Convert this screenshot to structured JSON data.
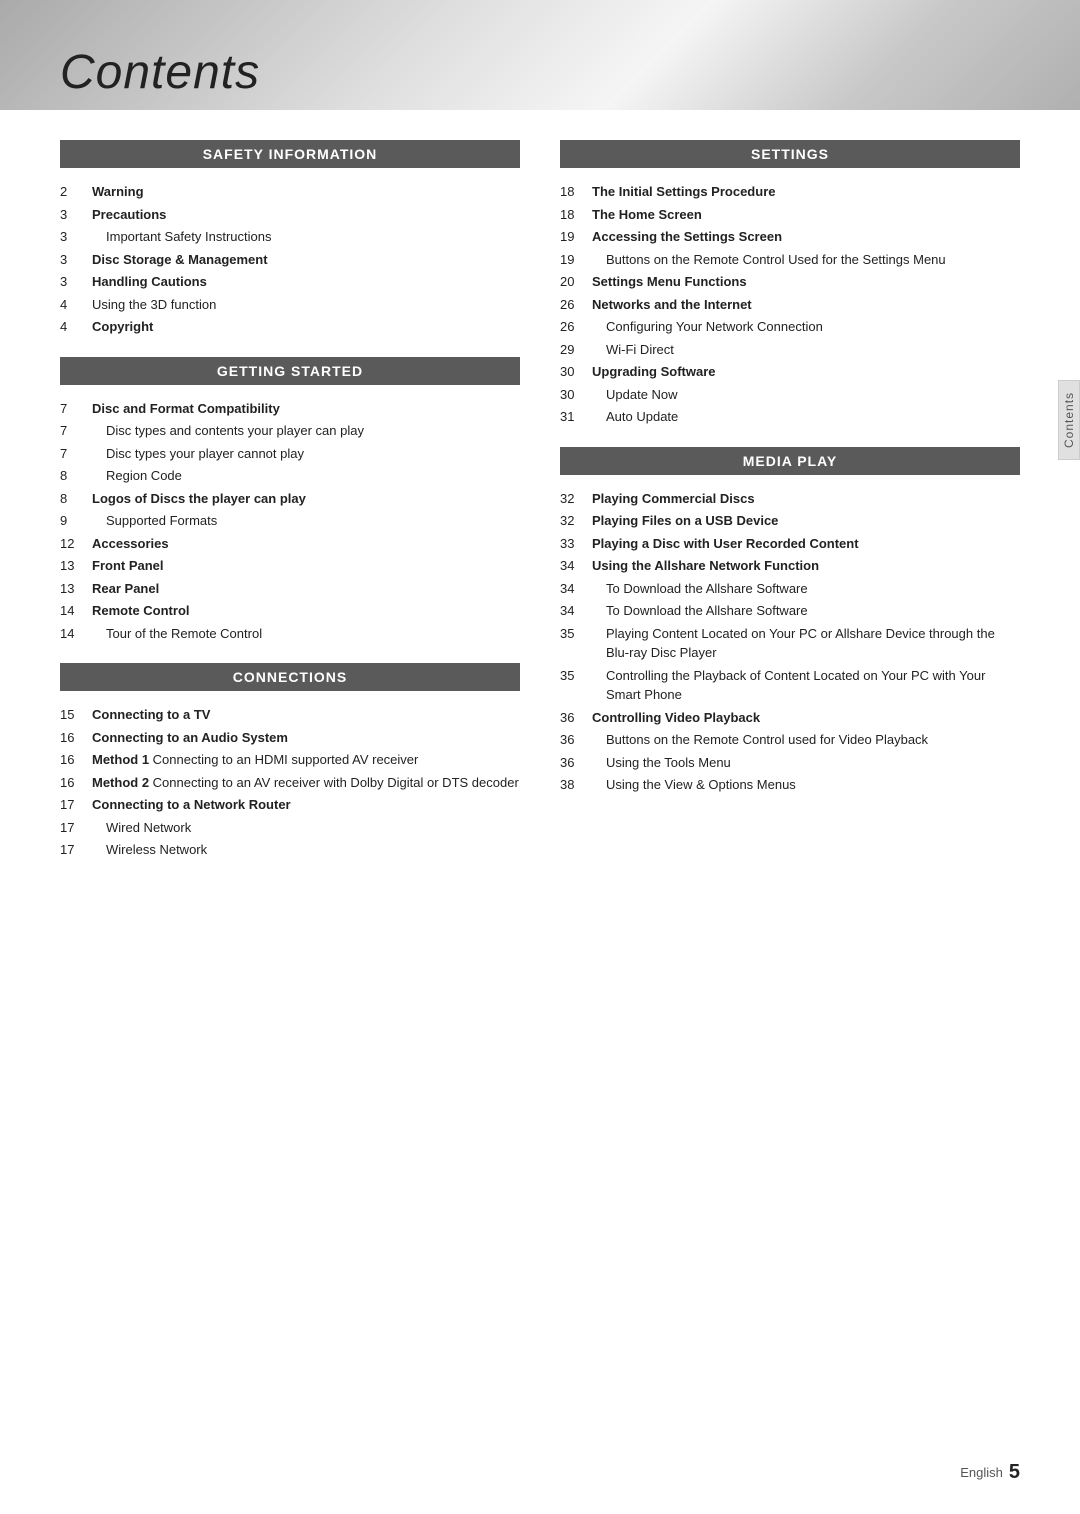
{
  "header": {
    "title": "Contents",
    "side_tab": "Contents"
  },
  "footer": {
    "label": "English",
    "page": "5"
  },
  "left_column": {
    "sections": [
      {
        "id": "safety",
        "header": "SAFETY INFORMATION",
        "entries": [
          {
            "num": "2",
            "text": "Warning",
            "style": "bold"
          },
          {
            "num": "3",
            "text": "Precautions",
            "style": "bold"
          },
          {
            "num": "3",
            "text": "Important Safety Instructions",
            "style": "indent"
          },
          {
            "num": "3",
            "text": "Disc Storage & Management",
            "style": "bold"
          },
          {
            "num": "3",
            "text": "Handling Cautions",
            "style": "bold"
          },
          {
            "num": "4",
            "text": "Using the 3D function",
            "style": "normal"
          },
          {
            "num": "4",
            "text": "Copyright",
            "style": "bold"
          }
        ]
      },
      {
        "id": "getting_started",
        "header": "GETTING STARTED",
        "entries": [
          {
            "num": "7",
            "text": "Disc and Format Compatibility",
            "style": "bold"
          },
          {
            "num": "7",
            "text": "Disc types and contents your player can play",
            "style": "indent"
          },
          {
            "num": "7",
            "text": "Disc types your player cannot play",
            "style": "indent"
          },
          {
            "num": "8",
            "text": "Region Code",
            "style": "indent"
          },
          {
            "num": "8",
            "text": "Logos of Discs the player can play",
            "style": "bold"
          },
          {
            "num": "9",
            "text": "Supported Formats",
            "style": "indent"
          },
          {
            "num": "12",
            "text": "Accessories",
            "style": "bold"
          },
          {
            "num": "13",
            "text": "Front Panel",
            "style": "bold"
          },
          {
            "num": "13",
            "text": "Rear Panel",
            "style": "bold"
          },
          {
            "num": "14",
            "text": "Remote Control",
            "style": "bold"
          },
          {
            "num": "14",
            "text": "Tour of the Remote Control",
            "style": "indent"
          }
        ]
      },
      {
        "id": "connections",
        "header": "CONNECTIONS",
        "entries": [
          {
            "num": "15",
            "text": "Connecting to a TV",
            "style": "bold"
          },
          {
            "num": "16",
            "text": "Connecting to an Audio System",
            "style": "bold"
          },
          {
            "num": "16",
            "text": "Method 1 Connecting to an HDMI supported AV receiver",
            "style": "method"
          },
          {
            "num": "16",
            "text": "Method 2 Connecting to an AV receiver with Dolby Digital or DTS decoder",
            "style": "method"
          },
          {
            "num": "17",
            "text": "Connecting to a Network Router",
            "style": "bold"
          },
          {
            "num": "17",
            "text": "Wired Network",
            "style": "indent"
          },
          {
            "num": "17",
            "text": "Wireless Network",
            "style": "indent"
          }
        ]
      }
    ]
  },
  "right_column": {
    "sections": [
      {
        "id": "settings",
        "header": "SETTINGS",
        "entries": [
          {
            "num": "18",
            "text": "The Initial Settings Procedure",
            "style": "bold"
          },
          {
            "num": "18",
            "text": "The Home Screen",
            "style": "bold"
          },
          {
            "num": "19",
            "text": "Accessing the Settings Screen",
            "style": "bold"
          },
          {
            "num": "19",
            "text": "Buttons on the Remote Control Used for the Settings Menu",
            "style": "indent"
          },
          {
            "num": "20",
            "text": "Settings Menu Functions",
            "style": "bold"
          },
          {
            "num": "26",
            "text": "Networks and the Internet",
            "style": "bold"
          },
          {
            "num": "26",
            "text": "Configuring Your Network Connection",
            "style": "indent"
          },
          {
            "num": "29",
            "text": "Wi-Fi Direct",
            "style": "indent"
          },
          {
            "num": "30",
            "text": "Upgrading Software",
            "style": "bold"
          },
          {
            "num": "30",
            "text": "Update Now",
            "style": "indent"
          },
          {
            "num": "31",
            "text": "Auto Update",
            "style": "indent"
          }
        ]
      },
      {
        "id": "media_play",
        "header": "MEDIA PLAY",
        "entries": [
          {
            "num": "32",
            "text": "Playing Commercial Discs",
            "style": "bold"
          },
          {
            "num": "32",
            "text": "Playing Files on a USB Device",
            "style": "bold"
          },
          {
            "num": "33",
            "text": "Playing a Disc with User Recorded Content",
            "style": "bold"
          },
          {
            "num": "34",
            "text": "Using the Allshare Network Function",
            "style": "bold"
          },
          {
            "num": "34",
            "text": "To Download the Allshare Software",
            "style": "indent"
          },
          {
            "num": "34",
            "text": "To Download the Allshare Software",
            "style": "indent"
          },
          {
            "num": "35",
            "text": "Playing Content Located on Your PC or Allshare Device through the Blu-ray Disc Player",
            "style": "indent"
          },
          {
            "num": "35",
            "text": "Controlling the Playback of Content Located on Your PC with Your Smart Phone",
            "style": "indent"
          },
          {
            "num": "36",
            "text": "Controlling Video Playback",
            "style": "bold"
          },
          {
            "num": "36",
            "text": "Buttons on the Remote Control used for Video Playback",
            "style": "indent"
          },
          {
            "num": "36",
            "text": "Using the Tools Menu",
            "style": "indent"
          },
          {
            "num": "38",
            "text": "Using the View & Options Menus",
            "style": "indent"
          }
        ]
      }
    ]
  }
}
